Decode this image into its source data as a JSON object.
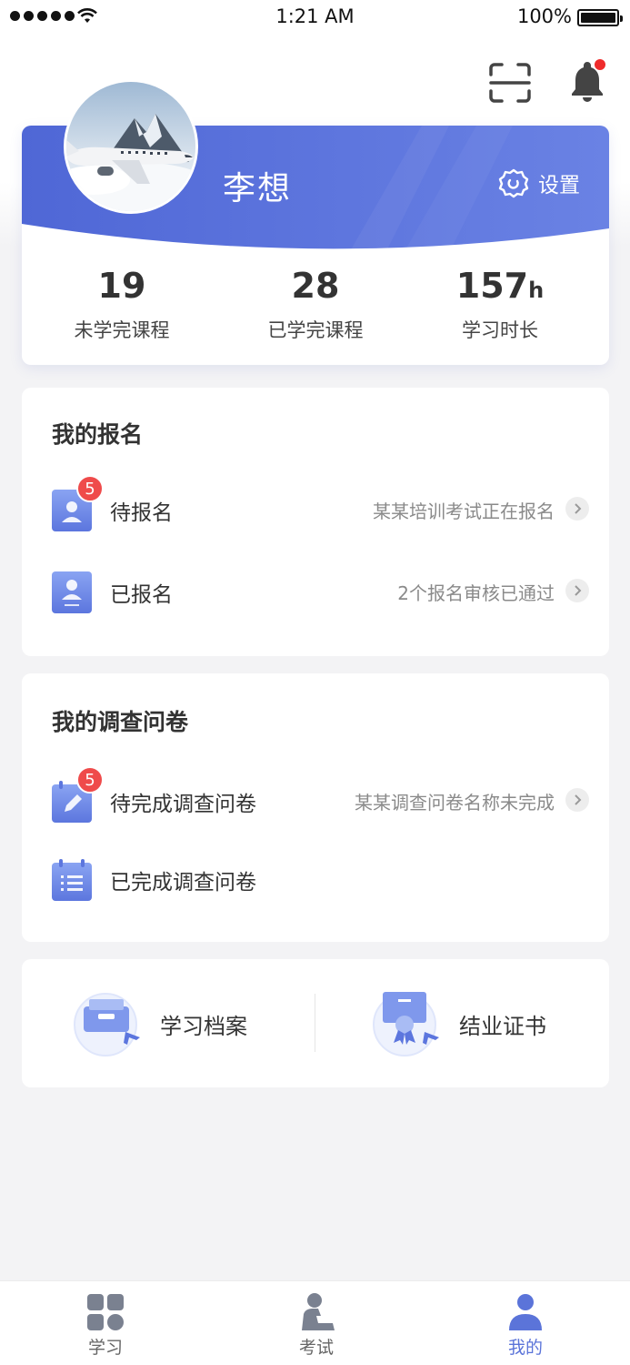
{
  "status_bar": {
    "time": "1:21 AM",
    "battery": "100%"
  },
  "profile": {
    "name": "李想",
    "settings_label": "设置",
    "stats": [
      {
        "value": "19",
        "unit": "",
        "label": "未学完课程"
      },
      {
        "value": "28",
        "unit": "",
        "label": "已学完课程"
      },
      {
        "value": "157",
        "unit": "h",
        "label": "学习时长"
      }
    ]
  },
  "registration": {
    "title": "我的报名",
    "items": [
      {
        "label": "待报名",
        "desc": "某某培训考试正在报名",
        "badge": "5"
      },
      {
        "label": "已报名",
        "desc": "2个报名审核已通过",
        "badge": ""
      }
    ]
  },
  "survey": {
    "title": "我的调查问卷",
    "items": [
      {
        "label": "待完成调查问卷",
        "desc": "某某调查问卷名称未完成",
        "badge": "5"
      },
      {
        "label": "已完成调查问卷",
        "desc": "",
        "badge": ""
      }
    ]
  },
  "quick_links": [
    {
      "label": "学习档案",
      "icon": "archive-icon"
    },
    {
      "label": "结业证书",
      "icon": "certificate-icon"
    }
  ],
  "tabs": [
    {
      "label": "学习",
      "icon": "grid-icon",
      "active": false
    },
    {
      "label": "考试",
      "icon": "exam-icon",
      "active": false
    },
    {
      "label": "我的",
      "icon": "user-icon",
      "active": true
    }
  ],
  "colors": {
    "accent": "#5b74d9",
    "badge": "#ef4b4b",
    "icon_gradient_top": "#8aa4f2",
    "icon_gradient_bottom": "#5c76de"
  }
}
